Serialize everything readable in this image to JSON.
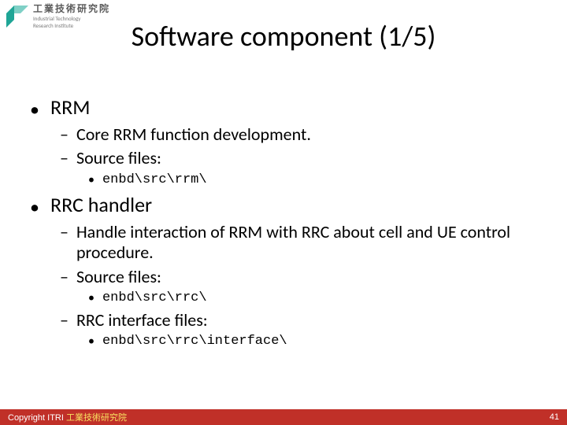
{
  "logo": {
    "cjk": "工業技術研究院",
    "en1": "Industrial Technology",
    "en2": "Research Institute"
  },
  "title": "Software component (1/5)",
  "bullets": [
    {
      "text": "RRM",
      "children": [
        {
          "text": "Core RRM function development.",
          "children": []
        },
        {
          "text": "Source files:",
          "children": [
            {
              "text": "enbd\\src\\rrm\\"
            }
          ]
        }
      ]
    },
    {
      "text": "RRC handler",
      "children": [
        {
          "text": "Handle interaction of RRM with RRC about cell and UE control procedure.",
          "children": []
        },
        {
          "text": "Source files:",
          "children": [
            {
              "text": "enbd\\src\\rrc\\"
            }
          ]
        },
        {
          "text": "RRC interface files:",
          "children": [
            {
              "text": "enbd\\src\\rrc\\interface\\"
            }
          ]
        }
      ]
    }
  ],
  "footer": {
    "copyright_prefix": "Copyright  ITRI ",
    "copyright_cjk": "工業技術研究院",
    "page": "41"
  }
}
